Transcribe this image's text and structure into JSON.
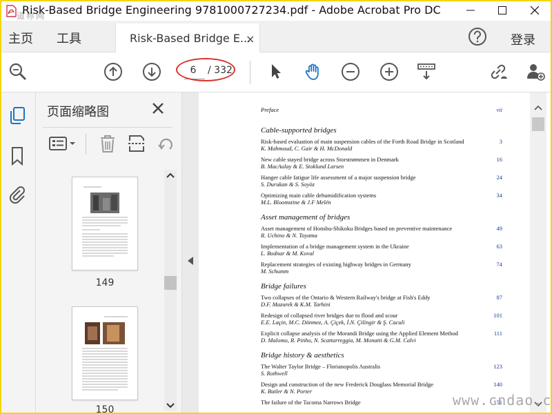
{
  "window": {
    "title": "Risk-Based Bridge Engineering 9781000727234.pdf - Adobe Acrobat Pro DC",
    "watermark_top": "道称网"
  },
  "menubar": {
    "home": "主页",
    "tools": "工具",
    "tab_label": "Risk-Based Bridge E...",
    "tab_close": "×",
    "login": "登录"
  },
  "toolbar": {
    "page_current": "6",
    "page_total": "/ 332"
  },
  "thumbnails": {
    "title": "页面缩略图",
    "pages": [
      "149",
      "150"
    ]
  },
  "toc": {
    "preface": {
      "title": "Preface",
      "page": "vii"
    },
    "sections": [
      {
        "heading": "Cable-supported bridges",
        "entries": [
          {
            "title": "Risk-based evaluation of main suspension cables of the Forth Road Bridge in Scotland",
            "authors": "K. Mahmoud, C. Gair & H. McDonald",
            "page": "3"
          },
          {
            "title": "New cable stayed bridge across Storstrømmen in Denmark",
            "authors": "B. MacAulay & E. Stoklund Larsen",
            "page": "16"
          },
          {
            "title": "Hanger cable fatigue life assessment of a major suspension bridge",
            "authors": "S. Durukan & S. Soyöz",
            "page": "24"
          },
          {
            "title": "Optimizing main cable dehumidification systems",
            "authors": "M.L. Bloomstine & J.F Melén",
            "page": "34"
          }
        ]
      },
      {
        "heading": "Asset management of bridges",
        "entries": [
          {
            "title": "Asset management of Honshu-Shikoku Bridges based on preventive maintenance",
            "authors": "R. Uchino & N. Toyama",
            "page": "49"
          },
          {
            "title": "Implementation of a bridge management system in the Ukraine",
            "authors": "L. Bodnar & M. Koval",
            "page": "63"
          },
          {
            "title": "Replacement strategies of existing highway bridges in Germany",
            "authors": "M. Schumm",
            "page": "74"
          }
        ]
      },
      {
        "heading": "Bridge failures",
        "entries": [
          {
            "title": "Two collapses of the Ontario & Western Railway's bridge at Fish's Eddy",
            "authors": "D.F. Mazurek & K.M. Tarhini",
            "page": "87"
          },
          {
            "title": "Redesign of collapsed river bridges due to flood and scour",
            "authors": "E.E. Laçin, M.C. Dönmez, A. Çiçek, İ.N. Çilingir & Ş. Caculi",
            "page": "101"
          },
          {
            "title": "Explicit collapse analysis of the Morandi Bridge using the Applied Element Method",
            "authors": "D. Malomo, R. Pinho, N. Scattarreggia, M. Monatti & G.M. Calvi",
            "page": "111"
          }
        ]
      },
      {
        "heading": "Bridge history & aesthetics",
        "entries": [
          {
            "title": "The Walter Taylor Bridge – Florianopolis Australis",
            "authors": "S. Rothwell",
            "page": "123"
          },
          {
            "title": "Design and construction of the new Frederick Douglass Memorial Bridge",
            "authors": "K. Butler & N. Porter",
            "page": "140"
          },
          {
            "title": "The failure of the Tacoma Narrows Bridge",
            "authors": "",
            "page": "151"
          }
        ]
      }
    ]
  },
  "watermark_bottom": "www.cndao.com",
  "colors": {
    "accent": "#1a73c8",
    "ring": "#d9302a",
    "link_number": "#1a3a9a"
  }
}
